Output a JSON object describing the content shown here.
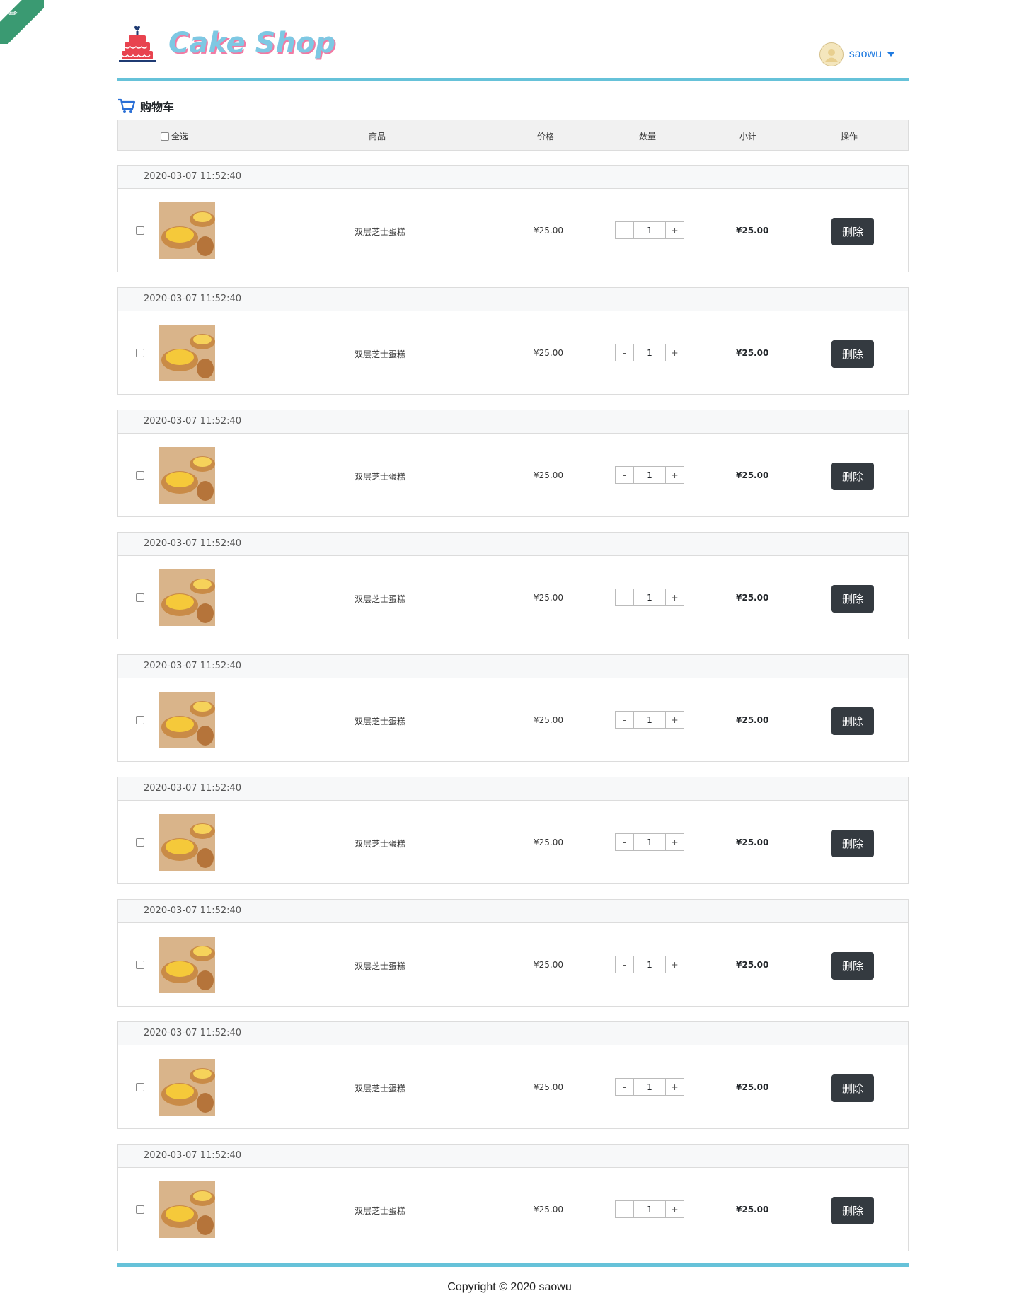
{
  "header": {
    "brand": "Cake Shop",
    "user": {
      "name": "saowu"
    }
  },
  "cart": {
    "title": "购物车",
    "columns": {
      "select_all": "全选",
      "product": "商品",
      "price": "价格",
      "quantity": "数量",
      "subtotal": "小计",
      "action": "操作"
    },
    "items": [
      {
        "date": "2020-03-07 11:52:40",
        "name": "双层芝士蛋糕",
        "price": "¥25.00",
        "qty": "1",
        "subtotal": "¥25.00",
        "delete": "删除"
      },
      {
        "date": "2020-03-07 11:52:40",
        "name": "双层芝士蛋糕",
        "price": "¥25.00",
        "qty": "1",
        "subtotal": "¥25.00",
        "delete": "删除"
      },
      {
        "date": "2020-03-07 11:52:40",
        "name": "双层芝士蛋糕",
        "price": "¥25.00",
        "qty": "1",
        "subtotal": "¥25.00",
        "delete": "删除"
      },
      {
        "date": "2020-03-07 11:52:40",
        "name": "双层芝士蛋糕",
        "price": "¥25.00",
        "qty": "1",
        "subtotal": "¥25.00",
        "delete": "删除"
      },
      {
        "date": "2020-03-07 11:52:40",
        "name": "双层芝士蛋糕",
        "price": "¥25.00",
        "qty": "1",
        "subtotal": "¥25.00",
        "delete": "删除"
      },
      {
        "date": "2020-03-07 11:52:40",
        "name": "双层芝士蛋糕",
        "price": "¥25.00",
        "qty": "1",
        "subtotal": "¥25.00",
        "delete": "删除"
      },
      {
        "date": "2020-03-07 11:52:40",
        "name": "双层芝士蛋糕",
        "price": "¥25.00",
        "qty": "1",
        "subtotal": "¥25.00",
        "delete": "删除"
      },
      {
        "date": "2020-03-07 11:52:40",
        "name": "双层芝士蛋糕",
        "price": "¥25.00",
        "qty": "1",
        "subtotal": "¥25.00",
        "delete": "删除"
      },
      {
        "date": "2020-03-07 11:52:40",
        "name": "双层芝士蛋糕",
        "price": "¥25.00",
        "qty": "1",
        "subtotal": "¥25.00",
        "delete": "删除"
      }
    ],
    "qty_decrement": "-",
    "qty_increment": "+"
  },
  "footer": {
    "copyright": "Copyright © 2020 saowu"
  },
  "colors": {
    "accent_line": "#66c2d9",
    "user_link": "#1f7ae0",
    "delete_button": "#343a40",
    "ribbon": "#3a9a72"
  },
  "icons": {
    "ribbon": "github-icon",
    "logo": "cake-icon",
    "cart": "cart-icon",
    "caret": "caret-down-icon"
  }
}
